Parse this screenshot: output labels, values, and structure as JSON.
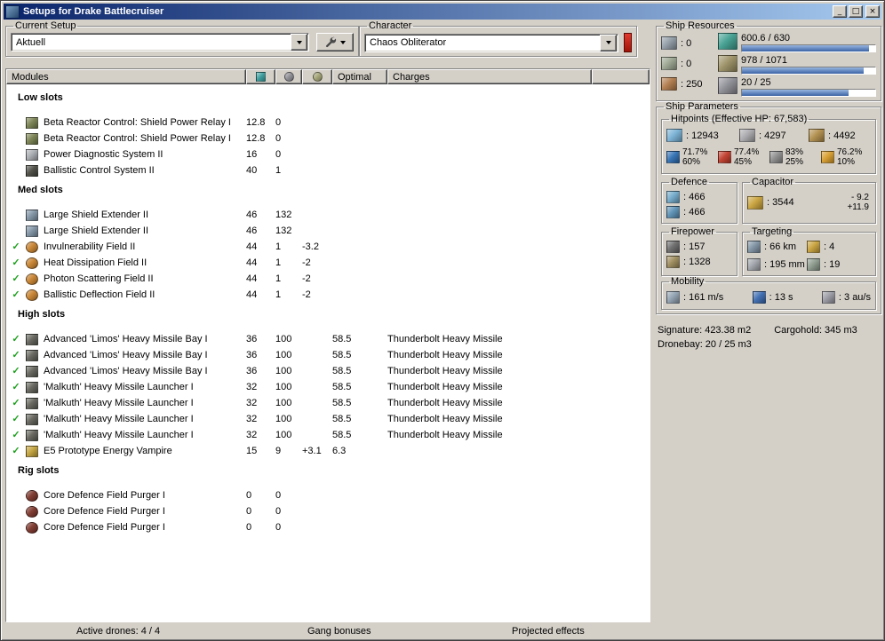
{
  "window": {
    "title": "Setups for Drake Battlecruiser",
    "minimize": "_",
    "maximize": "□",
    "close": "×"
  },
  "current_setup": {
    "label": "Current Setup",
    "value": "Aktuell"
  },
  "character": {
    "label": "Character",
    "value": "Chaos Obliterator",
    "indicator_color": "#c0281e"
  },
  "modules_table": {
    "header_modules": "Modules",
    "header_optimal": "Optimal",
    "header_charges": "Charges",
    "check_glyph": "✓",
    "sections": [
      {
        "title": "Low slots",
        "rows": [
          {
            "check": false,
            "icon": "shield-power-relay-icon",
            "color": "#77804f",
            "shape": "square",
            "name": "Beta Reactor Control: Shield Power Relay I",
            "cpu": "12.8",
            "pg": "0",
            "cap": "",
            "optimal": "",
            "charges": ""
          },
          {
            "check": false,
            "icon": "shield-power-relay-icon",
            "color": "#77804f",
            "shape": "square",
            "name": "Beta Reactor Control: Shield Power Relay I",
            "cpu": "12.8",
            "pg": "0",
            "cap": "",
            "optimal": "",
            "charges": ""
          },
          {
            "check": false,
            "icon": "power-diagnostic-icon",
            "color": "#a8abb0",
            "shape": "square",
            "name": "Power Diagnostic System II",
            "cpu": "16",
            "pg": "0",
            "cap": "",
            "optimal": "",
            "charges": ""
          },
          {
            "check": false,
            "icon": "ballistic-control-icon",
            "color": "#4a4a42",
            "shape": "square",
            "name": "Ballistic Control System II",
            "cpu": "40",
            "pg": "1",
            "cap": "",
            "optimal": "",
            "charges": ""
          }
        ]
      },
      {
        "title": "Med slots",
        "rows": [
          {
            "check": false,
            "icon": "shield-extender-icon",
            "color": "#7f93a4",
            "shape": "square",
            "name": "Large Shield Extender II",
            "cpu": "46",
            "pg": "132",
            "cap": "",
            "optimal": "",
            "charges": ""
          },
          {
            "check": false,
            "icon": "shield-extender-icon",
            "color": "#7f93a4",
            "shape": "square",
            "name": "Large Shield Extender II",
            "cpu": "46",
            "pg": "132",
            "cap": "",
            "optimal": "",
            "charges": ""
          },
          {
            "check": true,
            "icon": "invulnerability-field-icon",
            "color": "#c8822e",
            "shape": "circle",
            "name": "Invulnerability Field II",
            "cpu": "44",
            "pg": "1",
            "cap": "-3.2",
            "optimal": "",
            "charges": ""
          },
          {
            "check": true,
            "icon": "heat-dissipation-field-icon",
            "color": "#c8822e",
            "shape": "circle",
            "name": "Heat Dissipation Field II",
            "cpu": "44",
            "pg": "1",
            "cap": "-2",
            "optimal": "",
            "charges": ""
          },
          {
            "check": true,
            "icon": "photon-scattering-field-icon",
            "color": "#c8822e",
            "shape": "circle",
            "name": "Photon Scattering Field II",
            "cpu": "44",
            "pg": "1",
            "cap": "-2",
            "optimal": "",
            "charges": ""
          },
          {
            "check": true,
            "icon": "ballistic-deflection-field-icon",
            "color": "#c8822e",
            "shape": "circle",
            "name": "Ballistic Deflection Field II",
            "cpu": "44",
            "pg": "1",
            "cap": "-2",
            "optimal": "",
            "charges": ""
          }
        ]
      },
      {
        "title": "High slots",
        "rows": [
          {
            "check": true,
            "icon": "heavy-missile-bay-icon",
            "color": "#63635b",
            "shape": "square",
            "name": "Advanced 'Limos' Heavy Missile Bay I",
            "cpu": "36",
            "pg": "100",
            "cap": "",
            "optimal": "58.5",
            "charges": "Thunderbolt Heavy Missile"
          },
          {
            "check": true,
            "icon": "heavy-missile-bay-icon",
            "color": "#63635b",
            "shape": "square",
            "name": "Advanced 'Limos' Heavy Missile Bay I",
            "cpu": "36",
            "pg": "100",
            "cap": "",
            "optimal": "58.5",
            "charges": "Thunderbolt Heavy Missile"
          },
          {
            "check": true,
            "icon": "heavy-missile-bay-icon",
            "color": "#63635b",
            "shape": "square",
            "name": "Advanced 'Limos' Heavy Missile Bay I",
            "cpu": "36",
            "pg": "100",
            "cap": "",
            "optimal": "58.5",
            "charges": "Thunderbolt Heavy Missile"
          },
          {
            "check": true,
            "icon": "heavy-missile-launcher-icon",
            "color": "#63635b",
            "shape": "square",
            "name": "'Malkuth' Heavy Missile Launcher I",
            "cpu": "32",
            "pg": "100",
            "cap": "",
            "optimal": "58.5",
            "charges": "Thunderbolt Heavy Missile"
          },
          {
            "check": true,
            "icon": "heavy-missile-launcher-icon",
            "color": "#63635b",
            "shape": "square",
            "name": "'Malkuth' Heavy Missile Launcher I",
            "cpu": "32",
            "pg": "100",
            "cap": "",
            "optimal": "58.5",
            "charges": "Thunderbolt Heavy Missile"
          },
          {
            "check": true,
            "icon": "heavy-missile-launcher-icon",
            "color": "#63635b",
            "shape": "square",
            "name": "'Malkuth' Heavy Missile Launcher I",
            "cpu": "32",
            "pg": "100",
            "cap": "",
            "optimal": "58.5",
            "charges": "Thunderbolt Heavy Missile"
          },
          {
            "check": true,
            "icon": "heavy-missile-launcher-icon",
            "color": "#63635b",
            "shape": "square",
            "name": "'Malkuth' Heavy Missile Launcher I",
            "cpu": "32",
            "pg": "100",
            "cap": "",
            "optimal": "58.5",
            "charges": "Thunderbolt Heavy Missile"
          },
          {
            "check": true,
            "icon": "energy-vampire-icon",
            "color": "#c2a23a",
            "shape": "square",
            "name": "E5 Prototype Energy Vampire",
            "cpu": "15",
            "pg": "9",
            "cap": "+3.1",
            "optimal": "6.3",
            "charges": ""
          }
        ]
      },
      {
        "title": "Rig slots",
        "rows": [
          {
            "check": false,
            "icon": "defence-field-purger-icon",
            "color": "#7c352a",
            "shape": "circle",
            "name": "Core Defence Field Purger I",
            "cpu": "0",
            "pg": "0",
            "cap": "",
            "optimal": "",
            "charges": ""
          },
          {
            "check": false,
            "icon": "defence-field-purger-icon",
            "color": "#7c352a",
            "shape": "circle",
            "name": "Core Defence Field Purger I",
            "cpu": "0",
            "pg": "0",
            "cap": "",
            "optimal": "",
            "charges": ""
          },
          {
            "check": false,
            "icon": "defence-field-purger-icon",
            "color": "#7c352a",
            "shape": "circle",
            "name": "Core Defence Field Purger I",
            "cpu": "0",
            "pg": "0",
            "cap": "",
            "optimal": "",
            "charges": ""
          }
        ]
      }
    ]
  },
  "ship_resources": {
    "label": "Ship Resources",
    "hardpoints": [
      {
        "color": "#8f9aa4",
        "value": ": 0"
      },
      {
        "color": "#9aa48f",
        "value": ": 0"
      },
      {
        "color": "#b07a4a",
        "value": ": 250"
      }
    ],
    "gauges": [
      {
        "color": "#3f9e8f",
        "value": "600.6 / 630",
        "pct": "95%"
      },
      {
        "color": "#9a8f63",
        "value": "978 / 1071",
        "pct": "91%"
      },
      {
        "color": "#8c8c94",
        "value": "20 / 25",
        "pct": "80%"
      }
    ]
  },
  "ship_parameters": {
    "label": "Ship Parameters",
    "hitpoints": {
      "label": "Hitpoints (Effective HP: 67,583)",
      "hp": [
        {
          "color": "#77b0d4",
          "value": ": 12943"
        },
        {
          "color": "#a9a9ad",
          "value": ": 4297"
        },
        {
          "color": "#b08d4a",
          "value": ": 4492"
        }
      ],
      "resists": [
        {
          "color": "#2f6fb3",
          "shield": "71.7%",
          "armor": "60%"
        },
        {
          "color": "#c03b2a",
          "shield": "77.4%",
          "armor": "45%"
        },
        {
          "color": "#8c8c8c",
          "shield": "83%",
          "armor": "25%"
        },
        {
          "color": "#d79c2a",
          "shield": "76.2%",
          "armor": "10%"
        }
      ]
    },
    "defence": {
      "label": "Defence",
      "rows": [
        {
          "color": "#6fa8c9",
          "value": ": 466"
        },
        {
          "color": "#5a8fb4",
          "value": ": 466"
        }
      ]
    },
    "capacitor": {
      "label": "Capacitor",
      "color": "#c9a23a",
      "value": ": 3544",
      "delta_out": "- 9.2",
      "delta_in": "+11.9"
    },
    "firepower": {
      "label": "Firepower",
      "rows": [
        {
          "color": "#6a6a6a",
          "value": ": 157"
        },
        {
          "color": "#9c8a5a",
          "value": ": 1328"
        }
      ]
    },
    "targeting": {
      "label": "Targeting",
      "rows": [
        {
          "color": "#7f93a4",
          "value": ": 66 km"
        },
        {
          "color": "#c9a23a",
          "value": ": 4"
        },
        {
          "color": "#a0a4aa",
          "value": ": 195 mm"
        },
        {
          "color": "#8c9a8c",
          "value": ": 19"
        }
      ]
    },
    "mobility": {
      "label": "Mobility",
      "items": [
        {
          "color": "#8fa0b0",
          "value": ": 161 m/s"
        },
        {
          "color": "#3a6ab0",
          "value": ": 13 s"
        },
        {
          "color": "#9898a2",
          "value": ": 3 au/s"
        }
      ]
    }
  },
  "footer": {
    "signature": "Signature: 423.38 m2",
    "cargohold": "Cargohold: 345 m3",
    "dronebay": "Dronebay: 20 / 25 m3"
  },
  "statusbar": {
    "active_drones": "Active drones: 4 / 4",
    "gang_bonuses": "Gang bonuses",
    "projected_effects": "Projected effects"
  }
}
